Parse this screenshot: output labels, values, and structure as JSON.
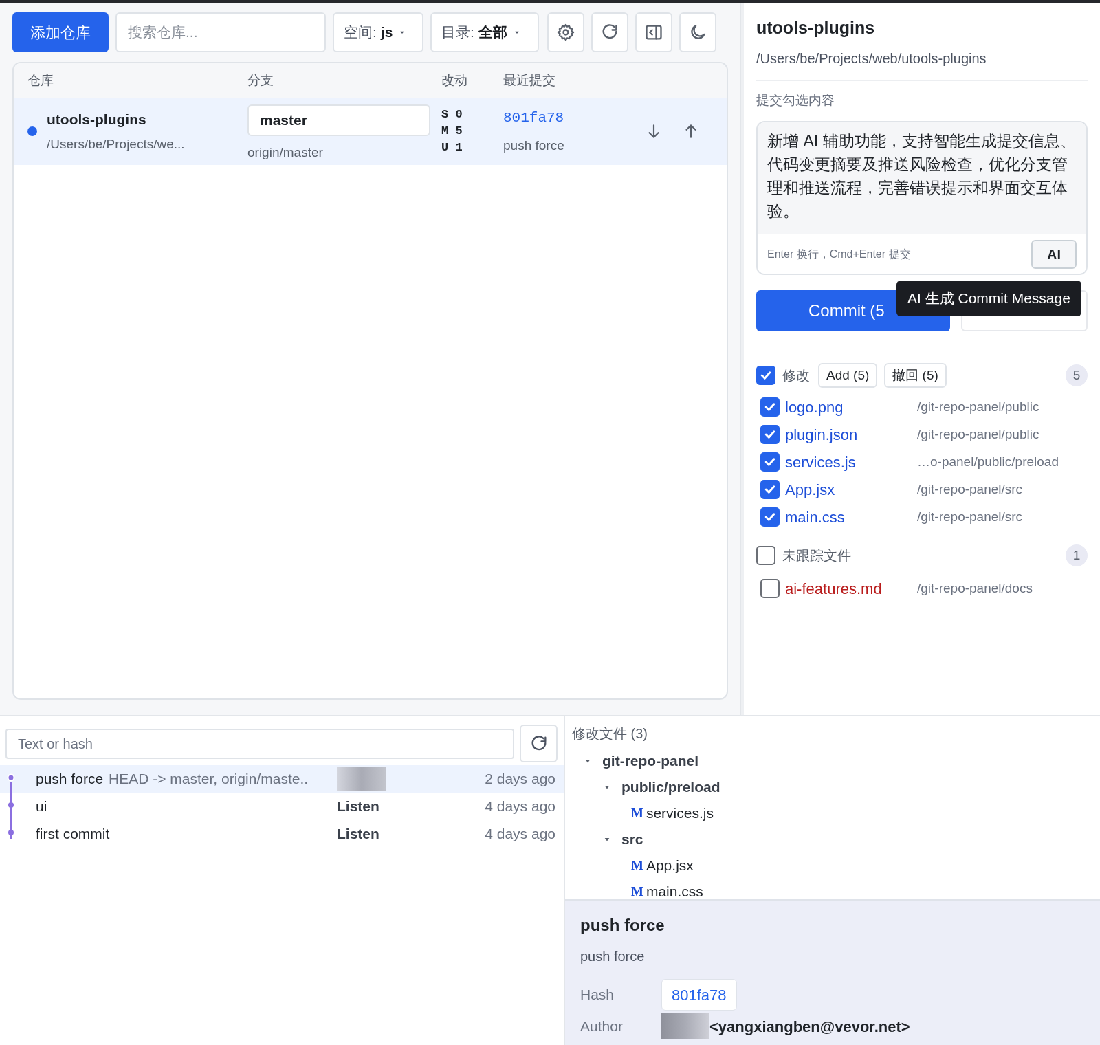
{
  "toolbar": {
    "add_button": "添加仓库",
    "search": {
      "placeholder": "搜索仓库..."
    },
    "filters": [
      {
        "label": "空间:",
        "value": "js"
      },
      {
        "label": "目录:",
        "value": "全部"
      }
    ]
  },
  "repo_table": {
    "columns": [
      "仓库",
      "分支",
      "改动",
      "最近提交"
    ],
    "rows": [
      {
        "name": "utools-plugins",
        "path": "/Users/be/Projects/we...",
        "selected": true,
        "branch": "master",
        "upstream": "origin/master",
        "changes": [
          {
            "letter": "S",
            "count": "0"
          },
          {
            "letter": "M",
            "count": "5"
          },
          {
            "letter": "U",
            "count": "1"
          }
        ],
        "hash": "801fa78",
        "message": "push force"
      }
    ]
  },
  "repo_detail": {
    "title": "utools-plugins",
    "path": "/Users/be/Projects/web/utools-plugins",
    "section_label": "提交勾选内容",
    "commit_message": "新增 AI 辅助功能，支持智能生成提交信息、代码变更摘要及推送风险检查，优化分支管理和推送流程，完善错误提示和界面交互体验。",
    "hint": "Enter 换行，Cmd+Enter 提交",
    "ai_button": "AI",
    "commit_button": "Commit (5",
    "tooltip": "AI 生成 Commit Message"
  },
  "change_groups": [
    {
      "label": "修改",
      "checked": true,
      "actions": [
        "Add (5)",
        "撤回 (5)"
      ],
      "count": "5",
      "files": [
        {
          "name": "logo.png",
          "dir": "/git-repo-panel/public",
          "checked": true,
          "kind": "modified"
        },
        {
          "name": "plugin.json",
          "dir": "/git-repo-panel/public",
          "checked": true,
          "kind": "modified"
        },
        {
          "name": "services.js",
          "dir": "…o-panel/public/preload",
          "checked": true,
          "kind": "modified"
        },
        {
          "name": "App.jsx",
          "dir": "/git-repo-panel/src",
          "checked": true,
          "kind": "modified"
        },
        {
          "name": "main.css",
          "dir": "/git-repo-panel/src",
          "checked": true,
          "kind": "modified"
        }
      ]
    },
    {
      "label": "未跟踪文件",
      "checked": false,
      "count": "1",
      "files": [
        {
          "name": "ai-features.md",
          "dir": "/git-repo-panel/docs",
          "checked": false,
          "kind": "untracked"
        }
      ]
    }
  ],
  "commit_log": {
    "search": {
      "placeholder": "Text or hash"
    },
    "commits": [
      {
        "message": "push force",
        "refs": "HEAD -> master, origin/maste..",
        "time": "2 days ago",
        "selected": true
      },
      {
        "message": "ui",
        "author": "Listen",
        "time": "4 days ago",
        "selected": false
      },
      {
        "message": "first commit",
        "author": "Listen",
        "time": "4 days ago",
        "selected": false
      }
    ]
  },
  "changed_files": {
    "title": "修改文件 (3)",
    "tree": [
      {
        "name": "git-repo-panel",
        "expanded": true,
        "children": [
          {
            "name": "public/preload",
            "expanded": true,
            "children": [
              {
                "name": "services.js",
                "status": "M"
              }
            ]
          },
          {
            "name": "src",
            "expanded": true,
            "children": [
              {
                "name": "App.jsx",
                "status": "M"
              },
              {
                "name": "main.css",
                "status": "M"
              }
            ]
          }
        ]
      }
    ]
  },
  "commit_detail": {
    "title": "push force",
    "body": "push force",
    "fields": [
      {
        "label": "Hash",
        "value": "801fa78",
        "kind": "hash"
      },
      {
        "label": "Author",
        "value": "<yangxiangben@vevor.net>",
        "kind": "author"
      }
    ]
  }
}
